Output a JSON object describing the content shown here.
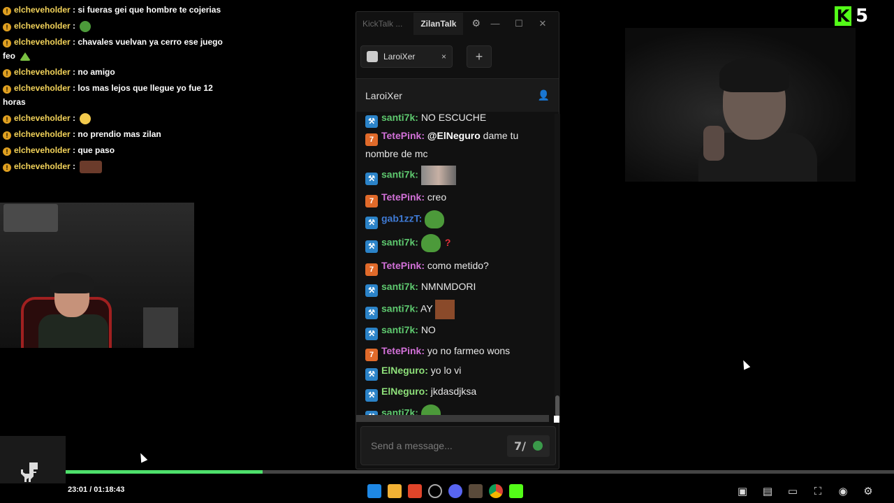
{
  "overlay_chat": {
    "messages": [
      {
        "user": "elcheveholder",
        "text": ": si fueras gei que hombre te cojerias",
        "emote": ""
      },
      {
        "user": "elcheveholder",
        "text": ":",
        "emote": "pepe"
      },
      {
        "user": "elcheveholder",
        "text": ": chavales vuelvan ya cerro ese juego feo",
        "emote": "triangle"
      },
      {
        "user": "elcheveholder",
        "text": ": no amigo",
        "emote": ""
      },
      {
        "user": "elcheveholder",
        "text": ": los mas lejos que llegue yo fue 12 horas",
        "emote": ""
      },
      {
        "user": "elcheveholder",
        "text": ":",
        "emote": "smile"
      },
      {
        "user": "elcheveholder",
        "text": ": no prendio mas zilan",
        "emote": ""
      },
      {
        "user": "elcheveholder",
        "text": ": que paso",
        "emote": ""
      },
      {
        "user": "elcheveholder",
        "text": ":",
        "emote": "picture"
      }
    ]
  },
  "kick_overlay": {
    "logo": "K",
    "number": "5",
    "color": "#53fc18"
  },
  "chat_window": {
    "app_name": "KickTalk ...",
    "active_tab": "ZilanTalk",
    "icons": {
      "settings": "gear-icon",
      "minimize": "minimize-icon",
      "maximize": "maximize-icon",
      "close": "close-icon"
    },
    "channel_tab": {
      "label": "LaroiXer",
      "close": "×"
    },
    "add_tab": "+",
    "channel_header": "LaroiXer",
    "messages": [
      {
        "badge": "mod",
        "user": "santi7k:",
        "user_class": "u-santi",
        "text": "NO ESCUCHE",
        "extra": ""
      },
      {
        "badge": "sub",
        "user": "TetePink:",
        "user_class": "u-tete",
        "mention": "@ElNeguro",
        "text": "dame tu nombre de mc",
        "extra": ""
      },
      {
        "badge": "mod",
        "user": "santi7k:",
        "user_class": "u-santi",
        "text": "",
        "extra": "img"
      },
      {
        "badge": "sub",
        "user": "TetePink:",
        "user_class": "u-tete",
        "text": "creo",
        "extra": ""
      },
      {
        "badge": "mod",
        "user": "gab1zzT:",
        "user_class": "u-gab",
        "text": "",
        "extra": "pepe"
      },
      {
        "badge": "mod",
        "user": "santi7k:",
        "user_class": "u-santi",
        "text": "",
        "extra": "pepe-q"
      },
      {
        "badge": "sub",
        "user": "TetePink:",
        "user_class": "u-tete",
        "text": "como metido?",
        "extra": ""
      },
      {
        "badge": "mod",
        "user": "santi7k:",
        "user_class": "u-santi",
        "text": "NMNMDORI",
        "extra": ""
      },
      {
        "badge": "mod",
        "user": "santi7k:",
        "user_class": "u-santi",
        "text": "AY",
        "extra": "face"
      },
      {
        "badge": "mod",
        "user": "santi7k:",
        "user_class": "u-santi",
        "text": "NO",
        "extra": ""
      },
      {
        "badge": "sub",
        "user": "TetePink:",
        "user_class": "u-tete",
        "text": "yo no farmeo wons",
        "extra": ""
      },
      {
        "badge": "mod",
        "user": "ElNeguro:",
        "user_class": "u-negu",
        "text": "yo lo vi",
        "extra": ""
      },
      {
        "badge": "mod",
        "user": "ElNeguro:",
        "user_class": "u-negu",
        "text": "jkdasdjksa",
        "extra": ""
      },
      {
        "badge": "mod",
        "user": "santi7k:",
        "user_class": "u-santi",
        "text": "",
        "extra": "pepe"
      }
    ],
    "question_mark": "?",
    "input_placeholder": "Send a message...",
    "seventv_label": "7/"
  },
  "player": {
    "time": "23:01 / 01:18:43",
    "progress_fraction": 0.238
  },
  "taskbar": {
    "center_icons": [
      "windows-start-icon",
      "file-explorer-icon",
      "brave-icon",
      "chatgpt-icon",
      "discord-icon",
      "box-icon",
      "chrome-icon",
      "kick-icon"
    ],
    "right_icons": [
      "widget-icon",
      "wallet-icon",
      "battery-icon",
      "capture-icon",
      "wifi-icon",
      "gear-icon"
    ]
  }
}
